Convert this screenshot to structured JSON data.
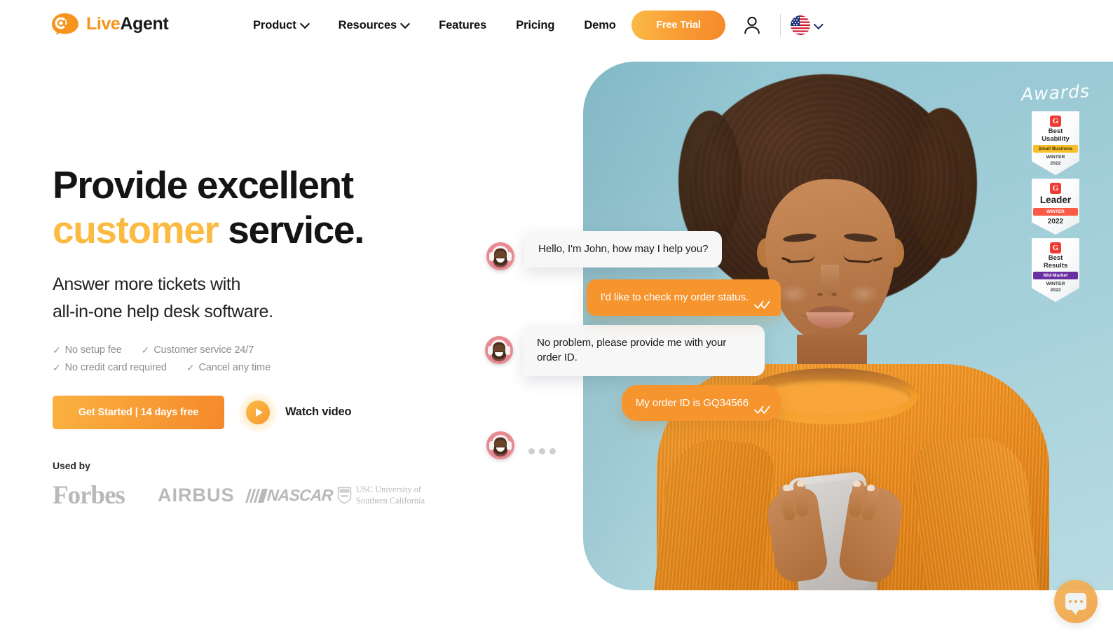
{
  "brand": {
    "name_part1": "Live",
    "name_part2": "Agent",
    "logo_icon": "at-speech-bubble-icon",
    "accent_color": "#F7941E",
    "yellow": "#FBBA41"
  },
  "header": {
    "nav": [
      {
        "label": "Product",
        "has_dropdown": true
      },
      {
        "label": "Resources",
        "has_dropdown": true
      },
      {
        "label": "Features",
        "has_dropdown": false
      },
      {
        "label": "Pricing",
        "has_dropdown": false
      },
      {
        "label": "Demo",
        "has_dropdown": false
      }
    ],
    "cta_label": "Free Trial",
    "account_icon": "user-person-icon",
    "language_flag": "us-flag-icon",
    "language_chevron": "chevron-down-icon"
  },
  "hero": {
    "headline_line1": "Provide excellent",
    "headline_accent": "customer",
    "headline_tail": " service.",
    "subhead_line1": "Answer more tickets with",
    "subhead_line2": "all-in-one help desk software.",
    "ticks": [
      "No setup fee",
      "Customer service 24/7",
      "No credit card required",
      "Cancel any time"
    ],
    "tick_glyph": "✓",
    "primary_cta": "Get Started | 14 days free",
    "watch_video_label": "Watch video",
    "play_icon": "play-triangle-icon"
  },
  "used_by": {
    "label": "Used by",
    "logos": [
      {
        "name": "Forbes",
        "text": "Forbes"
      },
      {
        "name": "Airbus",
        "text": "AIRBUS"
      },
      {
        "name": "NASCAR",
        "text": "NASCAR"
      },
      {
        "name": "USC",
        "line1": "USC University of",
        "line2": "Southern California"
      }
    ]
  },
  "awards": {
    "title": "Awards",
    "badges": [
      {
        "g2_mark": "G",
        "title_line1": "Best",
        "title_line2": "Usability",
        "ribbon": "Small Business",
        "ribbon_style": "sb",
        "season": "WINTER",
        "year": "2022"
      },
      {
        "g2_mark": "G",
        "title_line1": "Leader",
        "ribbon": "WINTER",
        "ribbon_style": "wt",
        "year": "2022"
      },
      {
        "g2_mark": "G",
        "title_line1": "Best",
        "title_line2": "Results",
        "ribbon": "Mid-Market",
        "ribbon_style": "mm",
        "season": "WINTER",
        "year": "2022"
      }
    ]
  },
  "chat": {
    "agent_avatar_icon": "agent-headset-avatar",
    "messages": [
      {
        "from": "agent",
        "text": "Hello, I'm John, how may I help you?"
      },
      {
        "from": "customer",
        "text": "I'd like to check my order status.",
        "read_receipt": "double-check-icon"
      },
      {
        "from": "agent",
        "text": "No problem, please provide me with your order ID."
      },
      {
        "from": "customer",
        "text": "My order ID is GQ34566",
        "read_receipt": "double-check-icon"
      }
    ],
    "typing_indicator": "typing-dots"
  },
  "chat_widget": {
    "icon": "chat-bubble-dots-icon",
    "color": "#EFA245"
  }
}
